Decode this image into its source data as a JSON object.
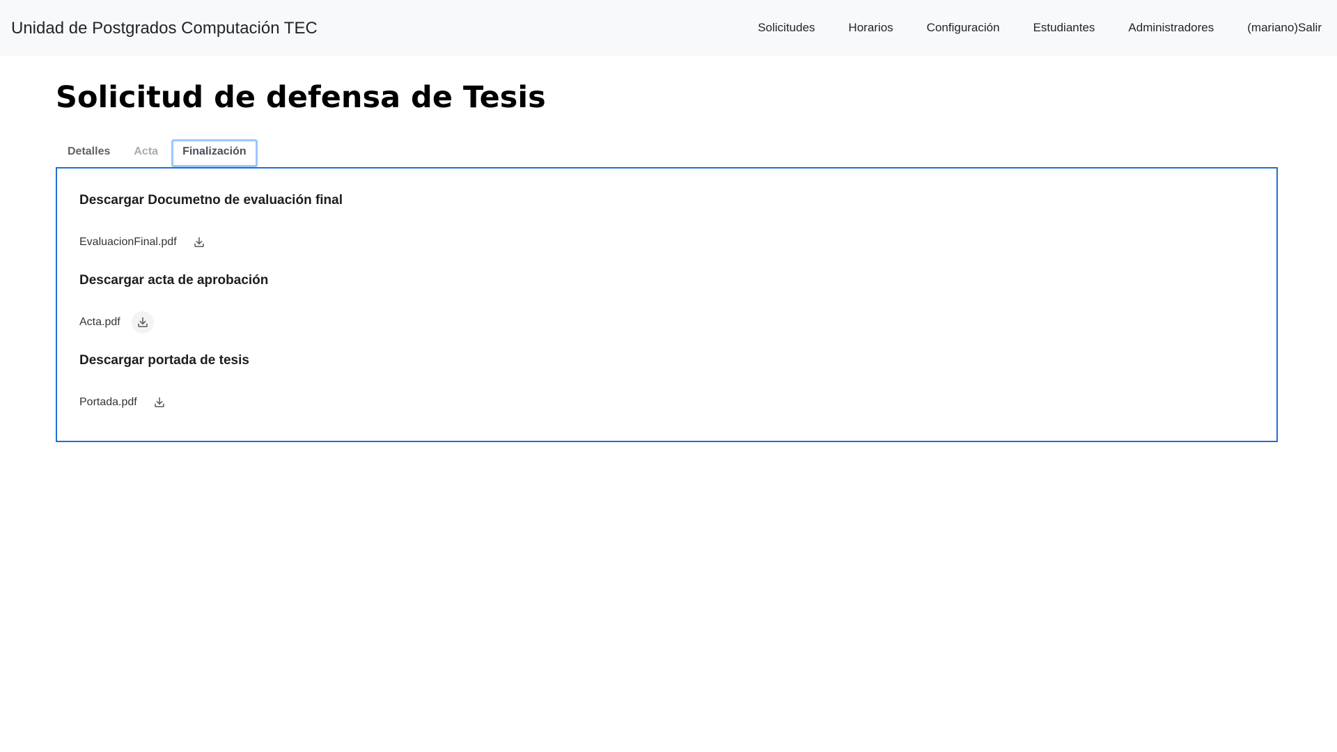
{
  "navbar": {
    "brand": "Unidad de Postgrados Computación TEC",
    "links": [
      {
        "label": "Solicitudes"
      },
      {
        "label": "Horarios"
      },
      {
        "label": "Configuración"
      },
      {
        "label": "Estudiantes"
      },
      {
        "label": "Administradores"
      },
      {
        "label": "(mariano)Salir"
      }
    ]
  },
  "page": {
    "title": "Solicitud de defensa de Tesis"
  },
  "tabs": [
    {
      "label": "Detalles",
      "state": "normal"
    },
    {
      "label": "Acta",
      "state": "disabled"
    },
    {
      "label": "Finalización",
      "state": "active"
    }
  ],
  "sections": [
    {
      "title": "Descargar Documetno de evaluación final",
      "file": "EvaluacionFinal.pdf",
      "icon": "download-icon"
    },
    {
      "title": "Descargar acta de aprobación",
      "file": "Acta.pdf",
      "icon": "download-icon"
    },
    {
      "title": "Descargar portada de tesis",
      "file": "Portada.pdf",
      "icon": "download-icon"
    }
  ],
  "colors": {
    "navbar_bg": "#f8f9fa",
    "panel_border": "#1f6fd1",
    "active_tab_border": "#9ec5fe"
  }
}
